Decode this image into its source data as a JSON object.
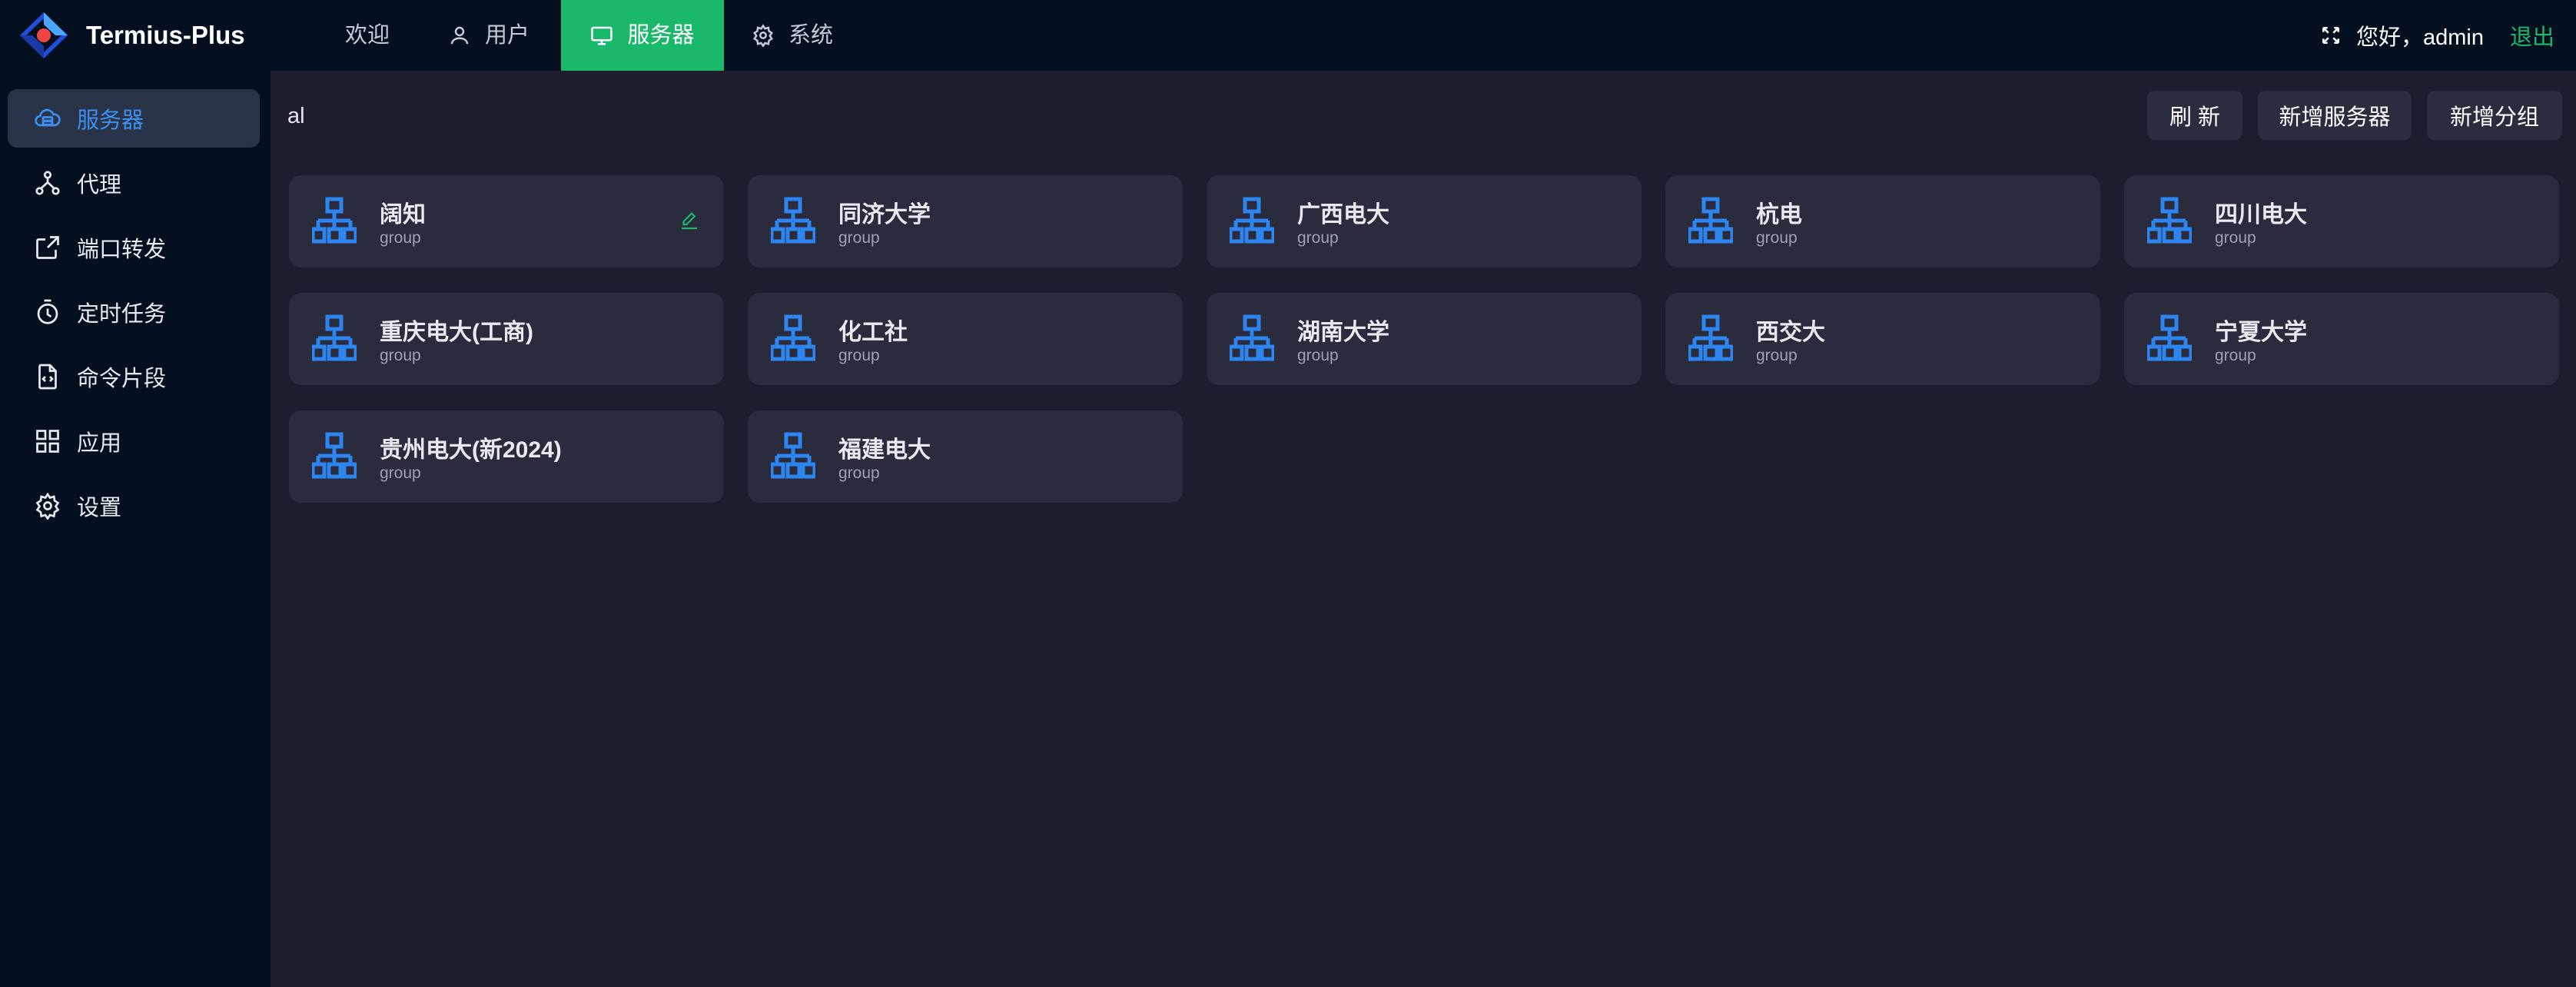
{
  "header": {
    "brand": "Termius-Plus",
    "nav": [
      {
        "label": "欢迎",
        "icon": "none"
      },
      {
        "label": "用户",
        "icon": "user-icon"
      },
      {
        "label": "服务器",
        "icon": "monitor-icon",
        "active": true
      },
      {
        "label": "系统",
        "icon": "gear-icon"
      }
    ],
    "greeting": "您好，admin",
    "logout": "退出"
  },
  "sidebar": {
    "items": [
      {
        "label": "服务器",
        "icon": "server-cloud-icon",
        "active": true
      },
      {
        "label": "代理",
        "icon": "network-icon"
      },
      {
        "label": "端口转发",
        "icon": "share-icon"
      },
      {
        "label": "定时任务",
        "icon": "timer-icon"
      },
      {
        "label": "命令片段",
        "icon": "code-file-icon"
      },
      {
        "label": "应用",
        "icon": "apps-grid-icon"
      },
      {
        "label": "设置",
        "icon": "settings-icon"
      }
    ]
  },
  "toolbar": {
    "search_value": "al",
    "refresh": "刷 新",
    "add_server": "新增服务器",
    "add_group": "新增分组"
  },
  "groups": [
    {
      "name": "阔知",
      "type": "group"
    },
    {
      "name": "同济大学",
      "type": "group"
    },
    {
      "name": "广西电大",
      "type": "group"
    },
    {
      "name": "杭电",
      "type": "group"
    },
    {
      "name": "四川电大",
      "type": "group"
    },
    {
      "name": "重庆电大(工商)",
      "type": "group"
    },
    {
      "name": "化工社",
      "type": "group"
    },
    {
      "name": "湖南大学",
      "type": "group"
    },
    {
      "name": "西交大",
      "type": "group"
    },
    {
      "name": "宁夏大学",
      "type": "group"
    },
    {
      "name": "贵州电大(新2024)",
      "type": "group"
    },
    {
      "name": "福建电大",
      "type": "group"
    }
  ],
  "colors": {
    "accent_green": "#1ab86a",
    "accent_blue": "#3e8ff0",
    "icon_blue": "#2d86f0",
    "background": "#1c1e2e",
    "nav_bg": "#04101f",
    "card_bg": "#2a2b3c"
  }
}
